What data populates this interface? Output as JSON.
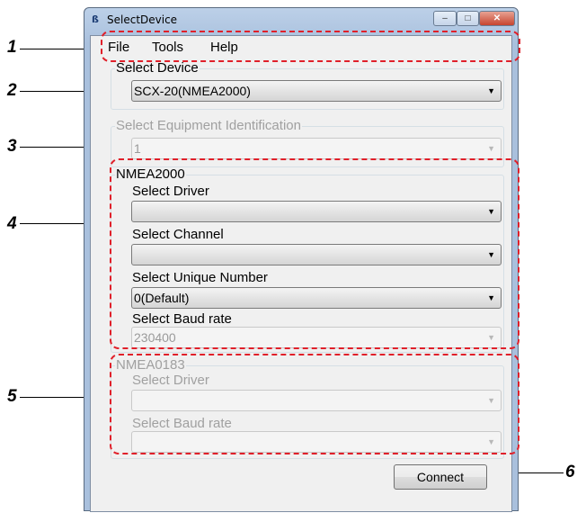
{
  "window": {
    "app_icon": "ß",
    "title": "SelectDevice",
    "min_glyph": "–",
    "max_glyph": "□",
    "close_glyph": "✕"
  },
  "menu": {
    "items": [
      "File",
      "Tools",
      "Help"
    ]
  },
  "select_device": {
    "label": "Select Device",
    "value": "SCX-20(NMEA2000)"
  },
  "equipment_id": {
    "label": "Select Equipment Identification",
    "value": "1"
  },
  "nmea2000": {
    "title": "NMEA2000",
    "driver_label": "Select Driver",
    "driver_value": "",
    "channel_label": "Select Channel",
    "channel_value": "",
    "unique_label": "Select Unique Number",
    "unique_value": "0(Default)",
    "baud_label": "Select Baud rate",
    "baud_value": "230400"
  },
  "nmea0183": {
    "title": "NMEA0183",
    "driver_label": "Select Driver",
    "driver_value": "",
    "baud_label": "Select Baud rate",
    "baud_value": ""
  },
  "connect_label": "Connect",
  "arrow_glyph": "▼",
  "callouts": [
    "1",
    "2",
    "3",
    "4",
    "5",
    "6"
  ],
  "colors": {
    "callout_dash": "#e0202a",
    "close_button": "#c7442e",
    "title_gradient": "#bcd0e8"
  }
}
